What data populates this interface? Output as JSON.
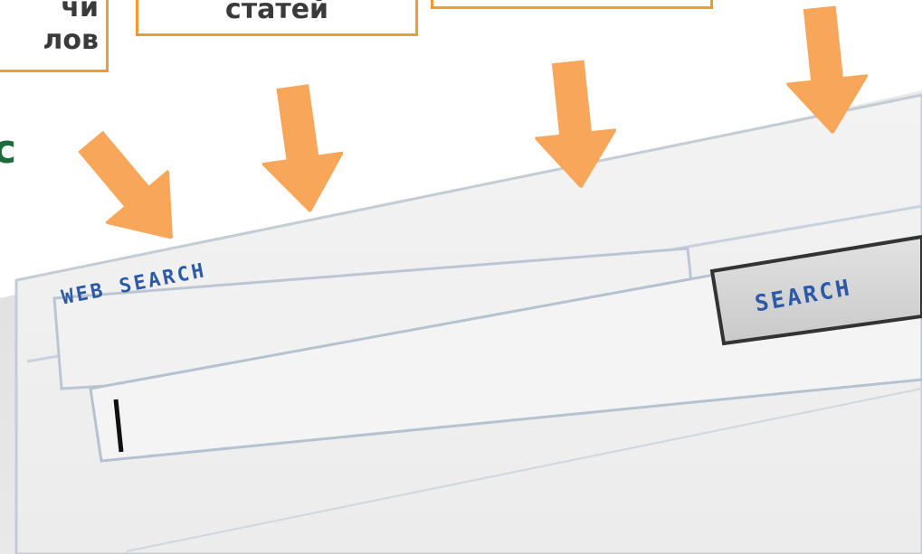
{
  "callouts": {
    "left_line1": "чи",
    "left_line2": "лов",
    "mid_text": "статей",
    "right_text": ""
  },
  "side_letter": "с",
  "search_panel": {
    "label": "WEB SEARCH",
    "button_label": "SEARCH",
    "input_value": ""
  },
  "colors": {
    "callout_border": "#f39c2b",
    "arrow_fill": "#f7a65a",
    "label_blue": "#2b5aa8",
    "side_letter": "#1e6b3c"
  },
  "icons": [
    "arrow-down-icon",
    "arrow-down-icon",
    "arrow-down-icon",
    "arrow-down-icon"
  ]
}
